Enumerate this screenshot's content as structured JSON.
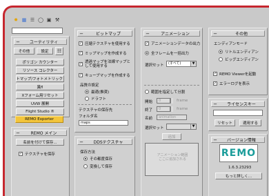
{
  "toolbar": {
    "icons": [
      "sun-icon",
      "image-icon",
      "stack-icon",
      "circle-icon",
      "window-icon",
      "hammer-icon"
    ]
  },
  "utility": {
    "title": "ユーティリティ",
    "top_buttons": [
      "その他",
      "設定"
    ],
    "buttons": [
      "ポリゴン カウンター",
      "リソース コレクター",
      "ビットマップ/フォトメトリック パス",
      "異fl",
      "Xフォーム用リセット",
      "UVW 展開",
      "Flight Studio ®",
      "REMO Exporter"
    ]
  },
  "remo_main": {
    "title": "REMO メイン",
    "save_button": "名前を付けて保存...",
    "texture_save": "テクスチャを保存"
  },
  "bitmap": {
    "title": "ビットマップ",
    "options": [
      "圧縮テクスチャを使用する",
      "ミップマップを作成する",
      "透過マップを法線マップとして使用する",
      "キューブマップを作成する"
    ],
    "quality_label": "品質の設定",
    "quality_options": [
      "最適(推奨)",
      "ドラフト"
    ],
    "folder_section": "テクスチャの保存先",
    "folder_label": "フォルダ名",
    "folder_value": "maps"
  },
  "dds": {
    "title": "DDSテクスチャ",
    "method_label": "保存方法",
    "options": [
      "その都度保存",
      "変換して保存"
    ]
  },
  "animation": {
    "title": "アニメーション",
    "options": [
      "アニメーションデータの出力",
      "全フレームを一括出力"
    ],
    "select_label": "選択セット",
    "select_value": "(すべて)",
    "range_option": "範囲を指定して分割",
    "start_label": "開始",
    "start_value": "0",
    "end_label": "終了",
    "end_value": "0",
    "unit": "frame",
    "name_label": "名前",
    "name_placeholder": "animation",
    "select2_label": "選択セット",
    "add_button": "追加",
    "list_hint1": "アニメーション範囲",
    "list_hint2": "ここに追加される"
  },
  "other": {
    "title": "その他",
    "endian_label": "エンディアンモード",
    "endian_options": [
      "リトルエンディアン",
      "ビッグエンディアン"
    ],
    "viewer_option": "REMO Viewerを起動",
    "log_option": "エラーログを表示"
  },
  "license": {
    "title": "ライセンスキー",
    "reset_button": "リセット",
    "apply_button": "適用する"
  },
  "version": {
    "title": "バージョン情報",
    "logo_text": "REMO",
    "version_value": "1.6.3.23293",
    "more_button": "もっと詳しく..."
  }
}
